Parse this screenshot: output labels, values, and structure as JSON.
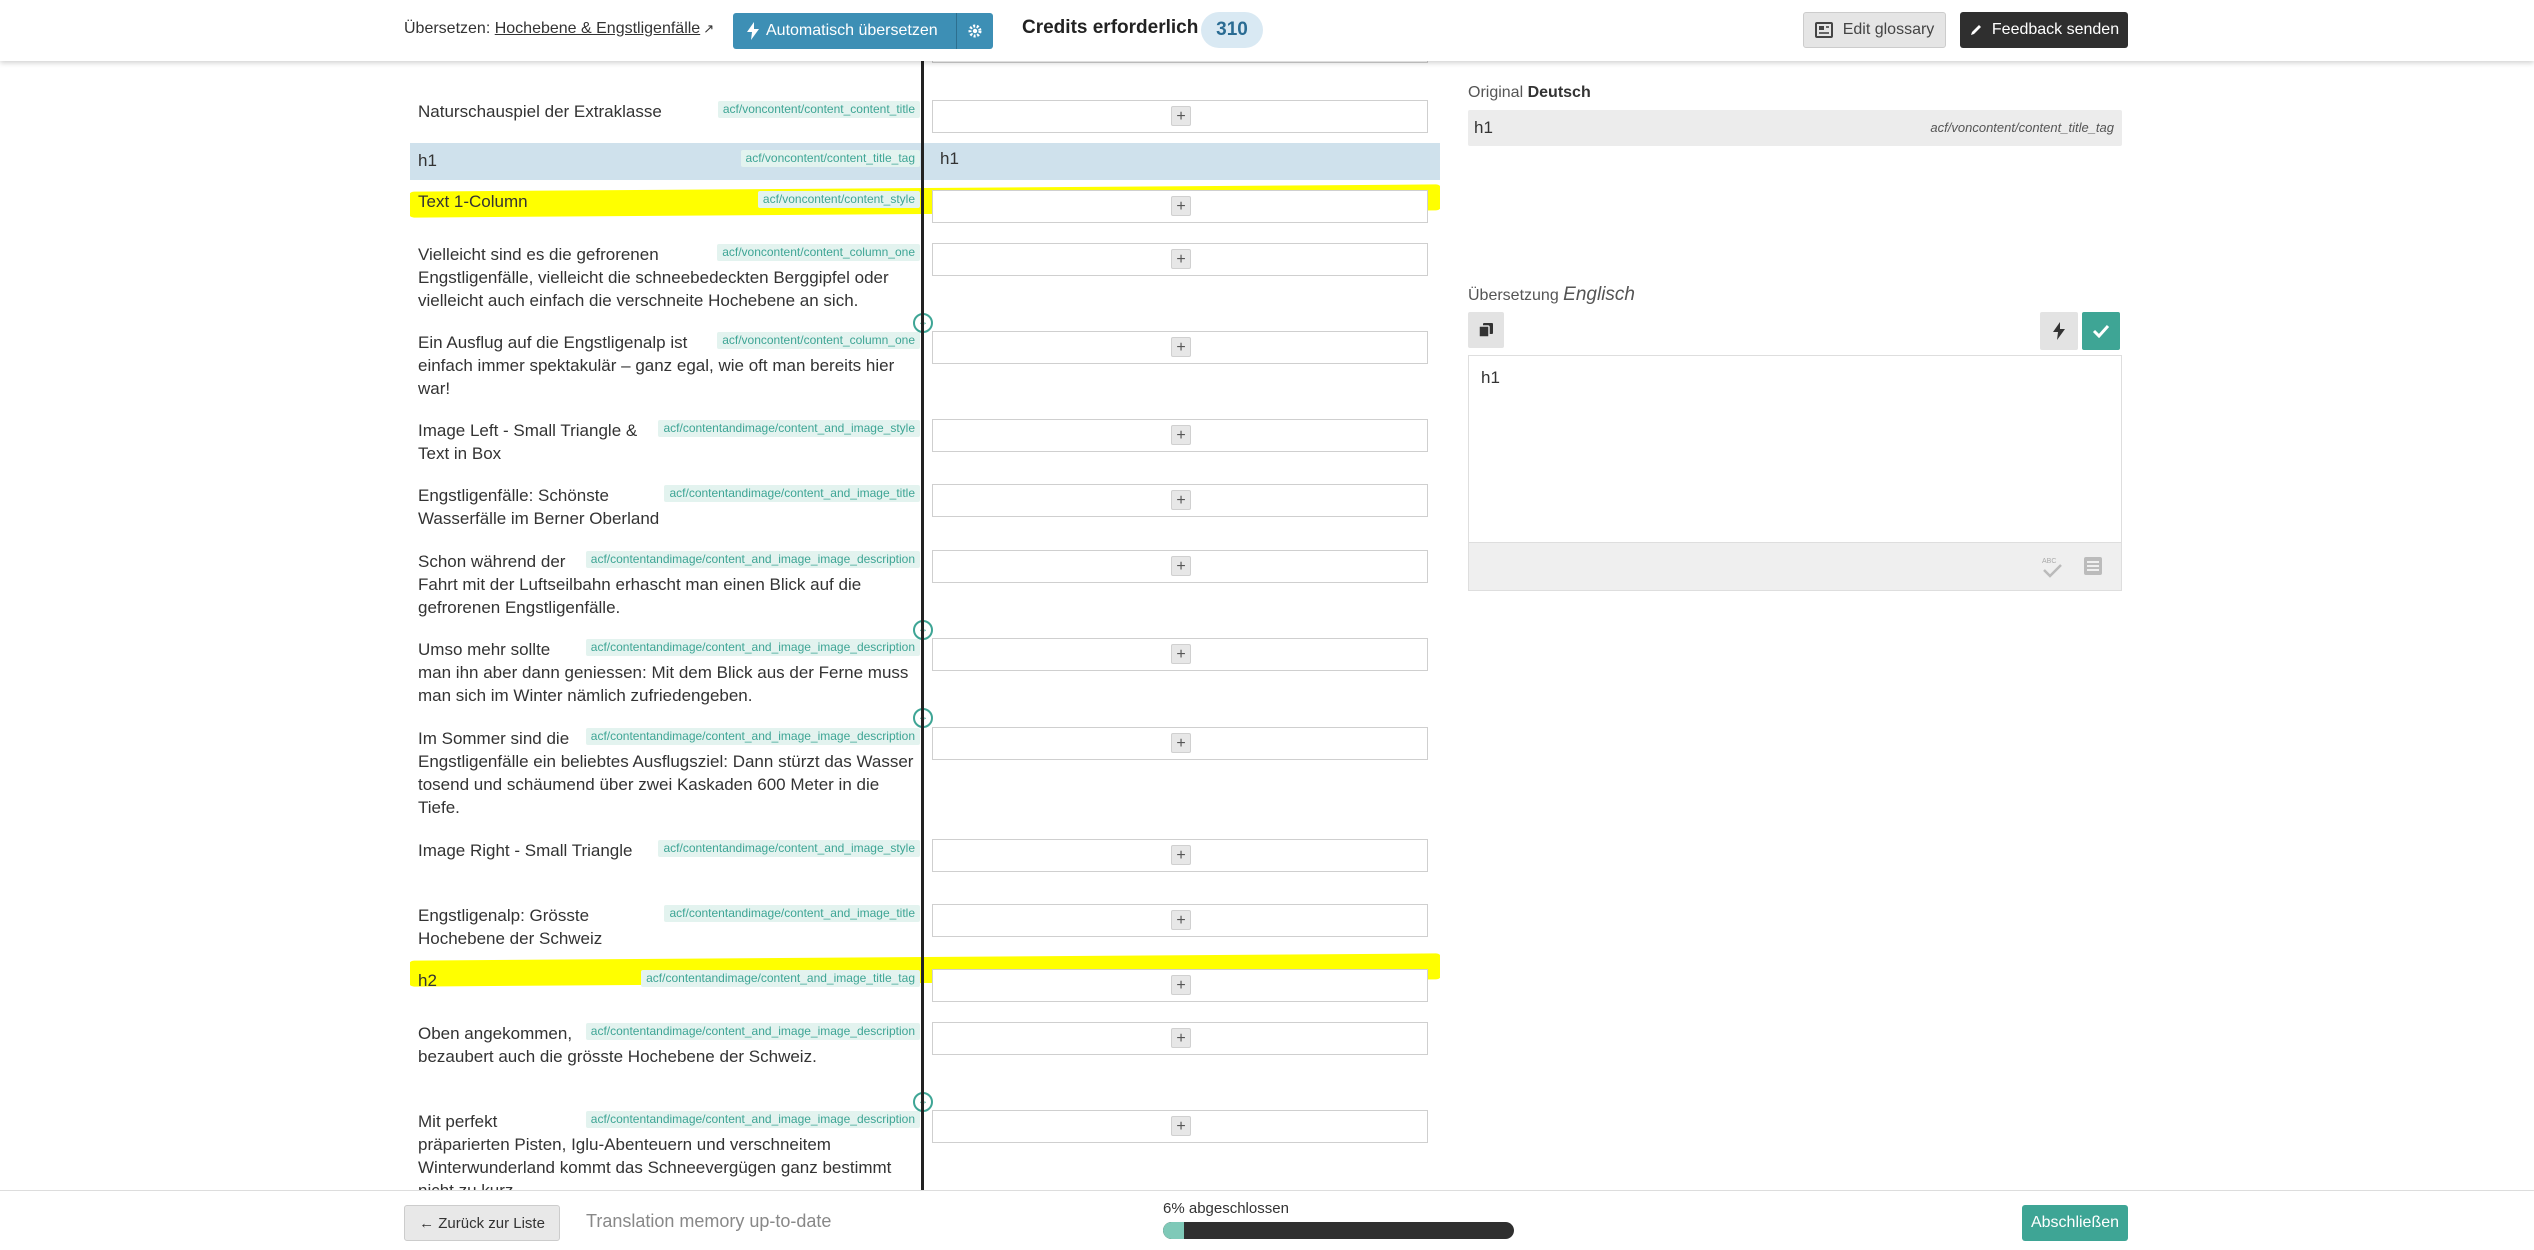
{
  "header": {
    "translate_label": "Übersetzen:",
    "document_link": "Hochebene & Engstligenfälle",
    "auto_translate_label": "Automatisch übersetzen",
    "credits_label": "Credits erforderlich",
    "credits_value": "310",
    "edit_glossary_label": "Edit glossary",
    "feedback_label": "Feedback senden"
  },
  "segments": [
    {
      "source": "Naturschauspiel der Extraklasse",
      "tag": "acf/voncontent/content_content_title"
    },
    {
      "source": "h1",
      "tag": "acf/voncontent/content_title_tag",
      "target": "h1"
    },
    {
      "source": "Text 1-Column",
      "tag": "acf/voncontent/content_style"
    },
    {
      "source": "Vielleicht sind es die gefrorenen Engstligenfälle, vielleicht die schneebedeckten Berggipfel oder vielleicht auch einfach die verschneite Hochebene an sich.",
      "tag": "acf/voncontent/content_column_one"
    },
    {
      "source": "Ein Ausflug auf die Engstligenalp ist einfach immer spektakulär – ganz egal, wie oft man bereits hier war!",
      "tag": "acf/voncontent/content_column_one"
    },
    {
      "source": "Image Left - Small Triangle & Text in Box",
      "tag": "acf/contentandimage/content_and_image_style"
    },
    {
      "source": "Engstligenfälle: Schönste Wasserfälle im Berner Oberland",
      "tag": "acf/contentandimage/content_and_image_title"
    },
    {
      "source": "Schon während der Fahrt mit der Luftseilbahn erhascht man einen Blick auf die gefrorenen Engstligenfälle.",
      "tag": "acf/contentandimage/content_and_image_image_description"
    },
    {
      "source": "Umso mehr sollte man ihn aber dann geniessen: Mit dem Blick aus der Ferne muss man sich im Winter nämlich zufriedengeben.",
      "tag": "acf/contentandimage/content_and_image_image_description"
    },
    {
      "source": "Im Sommer sind die Engstligenfälle ein beliebtes Ausflugsziel: Dann stürzt das Wasser tosend und schäumend über zwei Kaskaden 600 Meter in die Tiefe.",
      "tag": "acf/contentandimage/content_and_image_image_description"
    },
    {
      "source": "Image Right - Small Triangle",
      "tag": "acf/contentandimage/content_and_image_style"
    },
    {
      "source": "Engstligenalp: Grösste Hochebene der Schweiz",
      "tag": "acf/contentandimage/content_and_image_title"
    },
    {
      "source": "h2",
      "tag": "acf/contentandimage/content_and_image_title_tag"
    },
    {
      "source": "Oben angekommen, bezaubert auch die grösste Hochebene der Schweiz.",
      "tag": "acf/contentandimage/content_and_image_image_description"
    },
    {
      "source": "Mit perfekt präparierten Pisten, Iglu-Abenteuern und verschneitem Winterwunderland kommt das Schneevergügen ganz bestimmt nicht zu kurz.",
      "tag": "acf/contentandimage/content_and_image_image_description"
    }
  ],
  "add_symbol": "+",
  "panel": {
    "original_label": "Original",
    "original_language": "Deutsch",
    "original_text": "h1",
    "original_path": "acf/voncontent/content_title_tag",
    "translation_label": "Übersetzung",
    "translation_language": "Englisch",
    "translation_text": "h1"
  },
  "footer": {
    "back_label": "← Zurück zur Liste",
    "tm_status": "Translation memory up-to-date",
    "progress_label": "6% abgeschlossen",
    "progress_percent": 6,
    "finish_label": "Abschließen"
  },
  "colors": {
    "accent_blue": "#3d8fb5",
    "accent_green": "#3ea595",
    "highlight": "#ffff00",
    "active_row": "#cfe1ec"
  }
}
